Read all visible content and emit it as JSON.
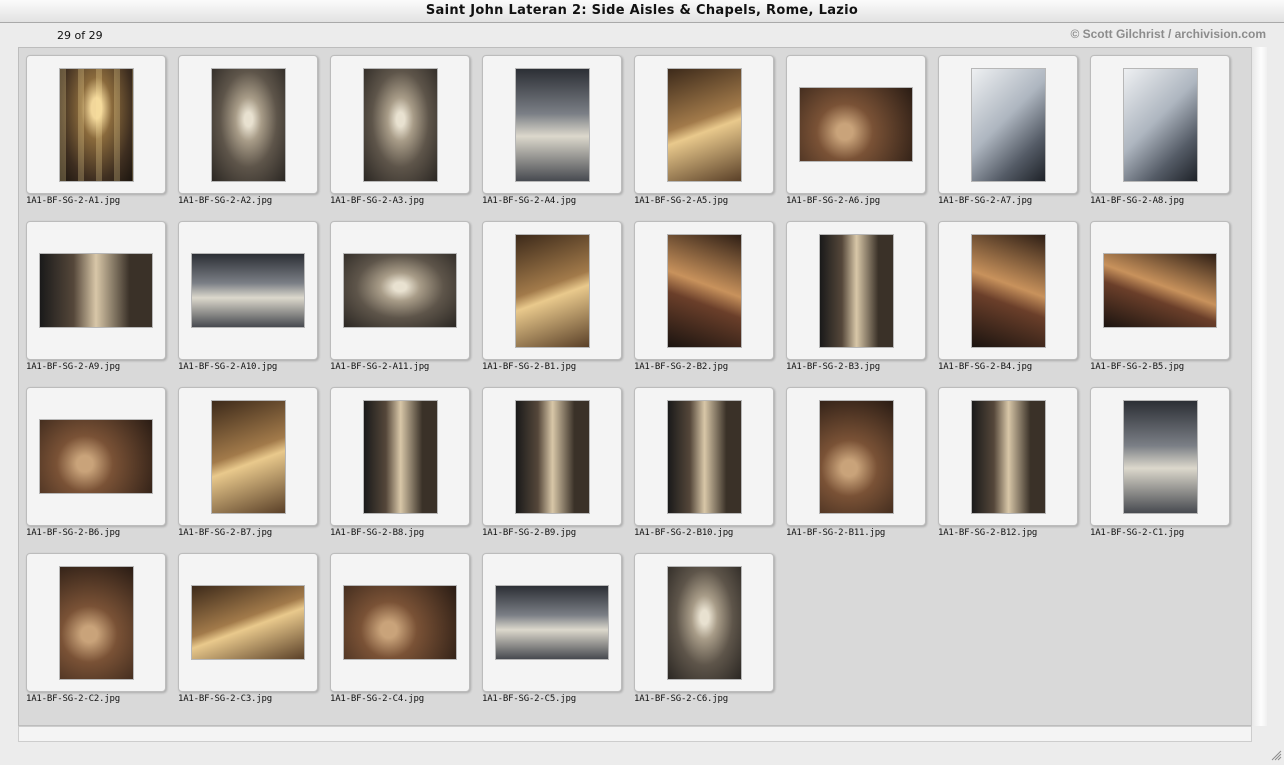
{
  "window": {
    "title": "Saint John Lateran 2: Side Aisles & Chapels, Rome, Lazio"
  },
  "status": {
    "count": "29 of 29",
    "copyright": "© Scott Gilchrist / archivision.com"
  },
  "thumbnails": [
    {
      "filename": "1A1-BF-SG-2-A1.jpg",
      "orientation": "portrait",
      "tone": "p1"
    },
    {
      "filename": "1A1-BF-SG-2-A2.jpg",
      "orientation": "portrait",
      "tone": "p2"
    },
    {
      "filename": "1A1-BF-SG-2-A3.jpg",
      "orientation": "portrait",
      "tone": "p2"
    },
    {
      "filename": "1A1-BF-SG-2-A4.jpg",
      "orientation": "portrait",
      "tone": "p4"
    },
    {
      "filename": "1A1-BF-SG-2-A5.jpg",
      "orientation": "portrait",
      "tone": "p3"
    },
    {
      "filename": "1A1-BF-SG-2-A6.jpg",
      "orientation": "landscape",
      "tone": "p6"
    },
    {
      "filename": "1A1-BF-SG-2-A7.jpg",
      "orientation": "portrait",
      "tone": "p7"
    },
    {
      "filename": "1A1-BF-SG-2-A8.jpg",
      "orientation": "portrait",
      "tone": "p7"
    },
    {
      "filename": "1A1-BF-SG-2-A9.jpg",
      "orientation": "landscape",
      "tone": "p8"
    },
    {
      "filename": "1A1-BF-SG-2-A10.jpg",
      "orientation": "landscape",
      "tone": "p4"
    },
    {
      "filename": "1A1-BF-SG-2-A11.jpg",
      "orientation": "landscape",
      "tone": "p2"
    },
    {
      "filename": "1A1-BF-SG-2-B1.jpg",
      "orientation": "portrait",
      "tone": "p3"
    },
    {
      "filename": "1A1-BF-SG-2-B2.jpg",
      "orientation": "portrait",
      "tone": "p5"
    },
    {
      "filename": "1A1-BF-SG-2-B3.jpg",
      "orientation": "portrait",
      "tone": "p8"
    },
    {
      "filename": "1A1-BF-SG-2-B4.jpg",
      "orientation": "portrait",
      "tone": "p5"
    },
    {
      "filename": "1A1-BF-SG-2-B5.jpg",
      "orientation": "landscape",
      "tone": "p5"
    },
    {
      "filename": "1A1-BF-SG-2-B6.jpg",
      "orientation": "landscape",
      "tone": "p6"
    },
    {
      "filename": "1A1-BF-SG-2-B7.jpg",
      "orientation": "portrait",
      "tone": "p3"
    },
    {
      "filename": "1A1-BF-SG-2-B8.jpg",
      "orientation": "portrait",
      "tone": "p8"
    },
    {
      "filename": "1A1-BF-SG-2-B9.jpg",
      "orientation": "portrait",
      "tone": "p8"
    },
    {
      "filename": "1A1-BF-SG-2-B10.jpg",
      "orientation": "portrait",
      "tone": "p8"
    },
    {
      "filename": "1A1-BF-SG-2-B11.jpg",
      "orientation": "portrait",
      "tone": "p6"
    },
    {
      "filename": "1A1-BF-SG-2-B12.jpg",
      "orientation": "portrait",
      "tone": "p8"
    },
    {
      "filename": "1A1-BF-SG-2-C1.jpg",
      "orientation": "portrait",
      "tone": "p4"
    },
    {
      "filename": "1A1-BF-SG-2-C2.jpg",
      "orientation": "portrait",
      "tone": "p6"
    },
    {
      "filename": "1A1-BF-SG-2-C3.jpg",
      "orientation": "landscape",
      "tone": "p3"
    },
    {
      "filename": "1A1-BF-SG-2-C4.jpg",
      "orientation": "landscape",
      "tone": "p6"
    },
    {
      "filename": "1A1-BF-SG-2-C5.jpg",
      "orientation": "landscape",
      "tone": "p4"
    },
    {
      "filename": "1A1-BF-SG-2-C6.jpg",
      "orientation": "portrait",
      "tone": "p2"
    }
  ]
}
